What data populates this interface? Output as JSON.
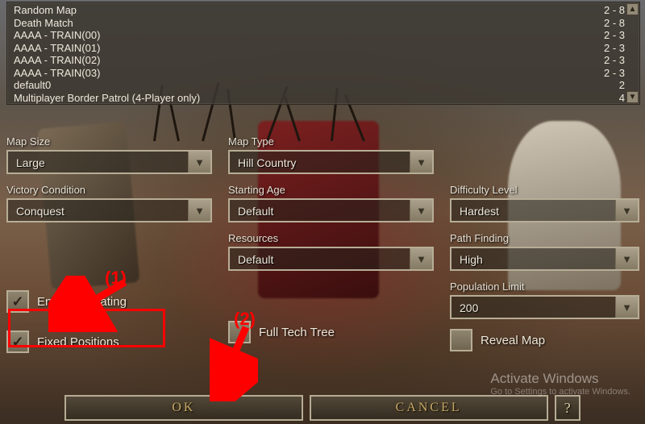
{
  "scenario_list": {
    "items": [
      {
        "name": "Random Map",
        "players": "2 - 8"
      },
      {
        "name": "Death Match",
        "players": "2 - 8"
      },
      {
        "name": "AAAA - TRAIN(00)",
        "players": "2 - 3"
      },
      {
        "name": "AAAA - TRAIN(01)",
        "players": "2 - 3"
      },
      {
        "name": "AAAA - TRAIN(02)",
        "players": "2 - 3"
      },
      {
        "name": "AAAA - TRAIN(03)",
        "players": "2 - 3"
      },
      {
        "name": "default0",
        "players": "2"
      },
      {
        "name": "Multiplayer Border Patrol (4-Player only)",
        "players": "4"
      }
    ]
  },
  "settings": {
    "map_size": {
      "label": "Map Size",
      "value": "Large"
    },
    "map_type": {
      "label": "Map Type",
      "value": "Hill Country"
    },
    "victory": {
      "label": "Victory Condition",
      "value": "Conquest"
    },
    "starting_age": {
      "label": "Starting Age",
      "value": "Default"
    },
    "difficulty": {
      "label": "Difficulty Level",
      "value": "Hardest"
    },
    "resources": {
      "label": "Resources",
      "value": "Default"
    },
    "path_finding": {
      "label": "Path Finding",
      "value": "High"
    },
    "pop_limit": {
      "label": "Population Limit",
      "value": "200"
    }
  },
  "checkboxes": {
    "enable_cheating": {
      "label": "Enable Cheating",
      "checked": true
    },
    "fixed_positions": {
      "label": "Fixed Positions",
      "checked": true
    },
    "full_tech_tree": {
      "label": "Full Tech Tree",
      "checked": false
    },
    "reveal_map": {
      "label": "Reveal Map",
      "checked": false
    }
  },
  "buttons": {
    "ok": "OK",
    "cancel": "CANCEL",
    "help": "?"
  },
  "annotations": {
    "one": "(1)",
    "two": "(2)"
  },
  "watermark": {
    "title": "Activate Windows",
    "sub": "Go to Settings to activate Windows."
  }
}
